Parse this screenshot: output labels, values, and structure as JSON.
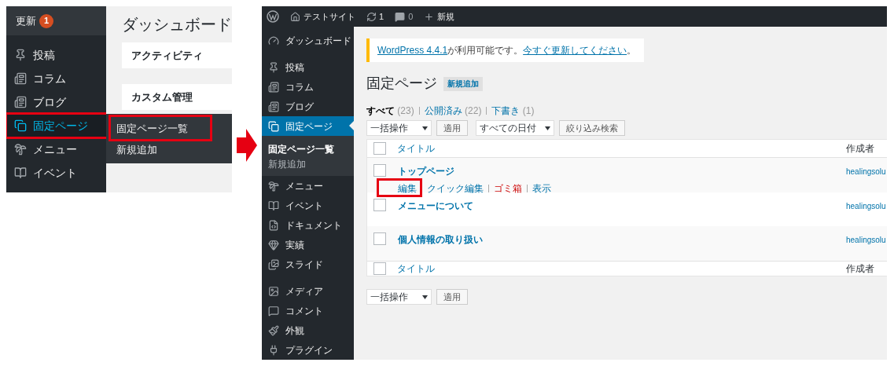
{
  "before": {
    "update_item": {
      "label": "更新",
      "badge": "1"
    },
    "menu_items": [
      {
        "label": "投稿",
        "selected": false,
        "annotated": false
      },
      {
        "label": "コラム",
        "selected": false,
        "annotated": false
      },
      {
        "label": "ブログ",
        "selected": false,
        "annotated": false
      },
      {
        "label": "固定ページ",
        "selected": true,
        "annotated": true
      },
      {
        "label": "メニュー",
        "selected": false,
        "annotated": false
      },
      {
        "label": "イベント",
        "selected": false,
        "annotated": false
      }
    ],
    "flyout": [
      {
        "label": "固定ページ一覧",
        "annotated": true
      },
      {
        "label": "新規追加",
        "annotated": false
      }
    ],
    "page_title": "ダッシュボード",
    "cards": [
      "アクティビティ",
      "カスタム管理"
    ]
  },
  "after": {
    "admin_bar": {
      "site_name": "テストサイト",
      "updates": "1",
      "comments": "0",
      "new": "新規"
    },
    "menu_groups": [
      [
        {
          "label": "ダッシュボード",
          "selected": false
        }
      ],
      [
        {
          "label": "投稿",
          "selected": false
        },
        {
          "label": "コラム",
          "selected": false
        },
        {
          "label": "ブログ",
          "selected": false
        },
        {
          "label": "固定ページ",
          "selected": true,
          "submenu": [
            {
              "label": "固定ページ一覧",
              "selected": true
            },
            {
              "label": "新規追加",
              "selected": false
            }
          ]
        },
        {
          "label": "メニュー",
          "selected": false
        },
        {
          "label": "イベント",
          "selected": false
        },
        {
          "label": "ドキュメント",
          "selected": false
        },
        {
          "label": "実績",
          "selected": false
        },
        {
          "label": "スライド",
          "selected": false
        }
      ],
      [
        {
          "label": "メディア",
          "selected": false
        },
        {
          "label": "コメント",
          "selected": false
        },
        {
          "label": "外観",
          "selected": false
        },
        {
          "label": "プラグイン",
          "selected": false
        }
      ]
    ],
    "notice": {
      "link": "WordPress 4.4.1",
      "text": "が利用可能です。",
      "action": "今すぐ更新してください",
      "end": "。"
    },
    "page_title": "固定ページ",
    "add_new": "新規追加",
    "views": [
      {
        "label": "すべて",
        "count": "(23)",
        "selected": true
      },
      {
        "label": "公開済み",
        "count": "(22)",
        "selected": false
      },
      {
        "label": "下書き",
        "count": "(1)",
        "selected": false
      }
    ],
    "bulk_action": "一括操作",
    "apply": "適用",
    "date_filter": "すべての日付",
    "filter_button": "絞り込み検索",
    "table": {
      "columns": [
        "タイトル",
        "作成者"
      ],
      "header_checked": false,
      "footer_checked": false,
      "rows": [
        {
          "title": "トップページ",
          "author": "healingsolu",
          "checked": false,
          "actions": [
            {
              "label": "編集",
              "kind": "normal",
              "annotated": true
            },
            {
              "label": "クイック編集",
              "kind": "normal",
              "annotated": false
            },
            {
              "label": "ゴミ箱",
              "kind": "delete",
              "annotated": false
            },
            {
              "label": "表示",
              "kind": "normal",
              "annotated": false
            }
          ]
        },
        {
          "title": "メニューについて",
          "author": "healingsolu",
          "checked": false,
          "actions": []
        },
        {
          "title": "個人情報の取り扱い",
          "author": "healingsolu",
          "checked": false,
          "actions": []
        }
      ],
      "footer": "タイトル",
      "footer_author": "作成者"
    },
    "bottom_bulk_action": "一括操作",
    "bottom_apply": "適用"
  }
}
